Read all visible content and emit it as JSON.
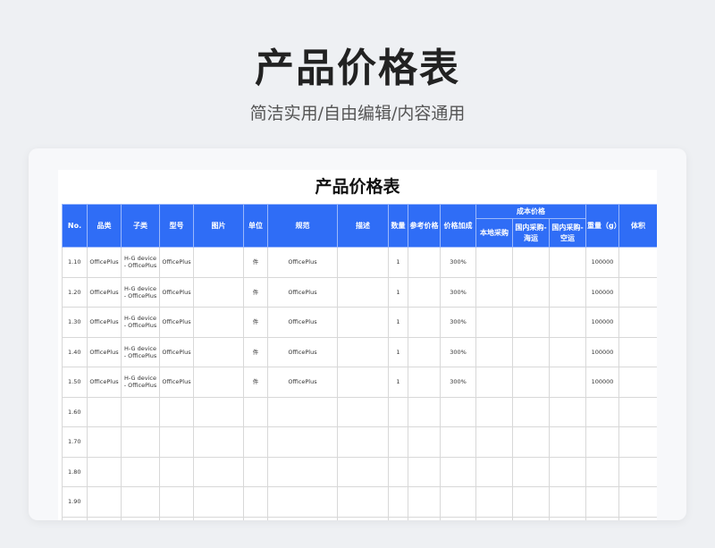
{
  "header": {
    "title": "产品价格表",
    "subtitle": "简洁实用/自由编辑/内容通用"
  },
  "sheet": {
    "title": "产品价格表",
    "columns": {
      "no": "No.",
      "category": "品类",
      "subcategory": "子类",
      "model": "型号",
      "image": "图片",
      "unit": "单位",
      "spec": "规范",
      "description": "描述",
      "quantity": "数量",
      "ref_price": "参考价格",
      "markup": "价格加成",
      "cost_group": "成本价格",
      "cost_local": "本地采购",
      "cost_sea": "国内采购-海运",
      "cost_air": "国内采购-空运",
      "weight": "重量（g）",
      "volume": "体积"
    },
    "rows": [
      {
        "no": "1.10",
        "category": "OfficePlus",
        "subcategory": "H-G device - OfficePlus",
        "model": "OfficePlus",
        "image": "",
        "unit": "件",
        "spec": "OfficePlus",
        "description": "",
        "quantity": "1",
        "ref_price": "",
        "markup": "300%",
        "cost_local": "",
        "cost_sea": "",
        "cost_air": "",
        "weight": "100000",
        "volume": ""
      },
      {
        "no": "1.20",
        "category": "OfficePlus",
        "subcategory": "H-G device - OfficePlus",
        "model": "OfficePlus",
        "image": "",
        "unit": "件",
        "spec": "OfficePlus",
        "description": "",
        "quantity": "1",
        "ref_price": "",
        "markup": "300%",
        "cost_local": "",
        "cost_sea": "",
        "cost_air": "",
        "weight": "100000",
        "volume": ""
      },
      {
        "no": "1.30",
        "category": "OfficePlus",
        "subcategory": "H-G device - OfficePlus",
        "model": "OfficePlus",
        "image": "",
        "unit": "件",
        "spec": "OfficePlus",
        "description": "",
        "quantity": "1",
        "ref_price": "",
        "markup": "300%",
        "cost_local": "",
        "cost_sea": "",
        "cost_air": "",
        "weight": "100000",
        "volume": ""
      },
      {
        "no": "1.40",
        "category": "OfficePlus",
        "subcategory": "H-G device - OfficePlus",
        "model": "OfficePlus",
        "image": "",
        "unit": "件",
        "spec": "OfficePlus",
        "description": "",
        "quantity": "1",
        "ref_price": "",
        "markup": "300%",
        "cost_local": "",
        "cost_sea": "",
        "cost_air": "",
        "weight": "100000",
        "volume": ""
      },
      {
        "no": "1.50",
        "category": "OfficePlus",
        "subcategory": "H-G device - OfficePlus",
        "model": "OfficePlus",
        "image": "",
        "unit": "件",
        "spec": "OfficePlus",
        "description": "",
        "quantity": "1",
        "ref_price": "",
        "markup": "300%",
        "cost_local": "",
        "cost_sea": "",
        "cost_air": "",
        "weight": "100000",
        "volume": ""
      },
      {
        "no": "1.60",
        "category": "",
        "subcategory": "",
        "model": "",
        "image": "",
        "unit": "",
        "spec": "",
        "description": "",
        "quantity": "",
        "ref_price": "",
        "markup": "",
        "cost_local": "",
        "cost_sea": "",
        "cost_air": "",
        "weight": "",
        "volume": ""
      },
      {
        "no": "1.70",
        "category": "",
        "subcategory": "",
        "model": "",
        "image": "",
        "unit": "",
        "spec": "",
        "description": "",
        "quantity": "",
        "ref_price": "",
        "markup": "",
        "cost_local": "",
        "cost_sea": "",
        "cost_air": "",
        "weight": "",
        "volume": ""
      },
      {
        "no": "1.80",
        "category": "",
        "subcategory": "",
        "model": "",
        "image": "",
        "unit": "",
        "spec": "",
        "description": "",
        "quantity": "",
        "ref_price": "",
        "markup": "",
        "cost_local": "",
        "cost_sea": "",
        "cost_air": "",
        "weight": "",
        "volume": ""
      },
      {
        "no": "1.90",
        "category": "",
        "subcategory": "",
        "model": "",
        "image": "",
        "unit": "",
        "spec": "",
        "description": "",
        "quantity": "",
        "ref_price": "",
        "markup": "",
        "cost_local": "",
        "cost_sea": "",
        "cost_air": "",
        "weight": "",
        "volume": ""
      },
      {
        "no": "",
        "category": "",
        "subcategory": "",
        "model": "",
        "image": "",
        "unit": "",
        "spec": "",
        "description": "",
        "quantity": "",
        "ref_price": "",
        "markup": "",
        "cost_local": "",
        "cost_sea": "",
        "cost_air": "",
        "weight": "",
        "volume": ""
      }
    ]
  },
  "colors": {
    "header_bg": "#2f6df6",
    "page_bg": "#eef0f3"
  }
}
